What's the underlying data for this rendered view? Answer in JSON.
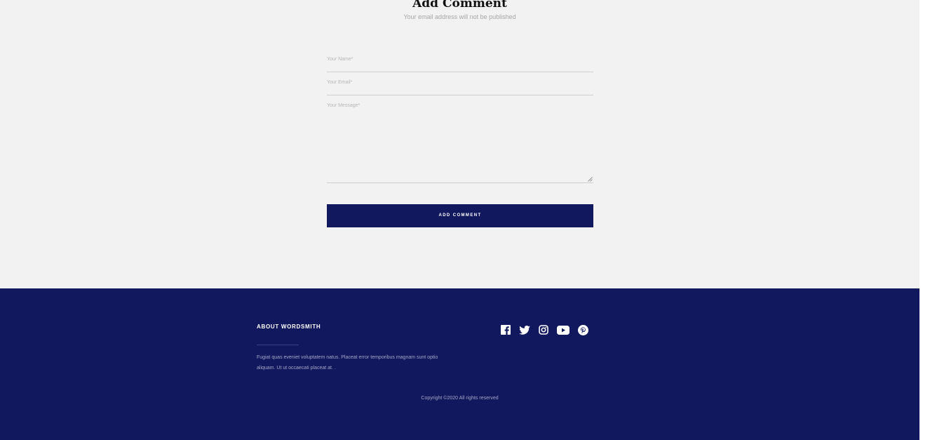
{
  "comment": {
    "title": "Add Comment",
    "subtitle": "Your email address will not be published",
    "name_placeholder": "Your Name*",
    "email_placeholder": "Your Email*",
    "message_placeholder": "Your Message*",
    "submit_label": "ADD COMMENT"
  },
  "footer": {
    "about_title": "ABOUT WORDSMITH",
    "about_text": "Fugiat quas eveniet voluptatem natus. Placeat error temporibus magnam sunt optio aliquam. Ut ut occaecati placeat at. .",
    "copyright": "Copyright ©2020 All rights reserved",
    "social_icons": [
      "facebook-icon",
      "twitter-icon",
      "instagram-icon",
      "youtube-icon",
      "pinterest-icon"
    ]
  },
  "colors": {
    "accent": "#12185e",
    "page_background": "#f2f2f2"
  }
}
